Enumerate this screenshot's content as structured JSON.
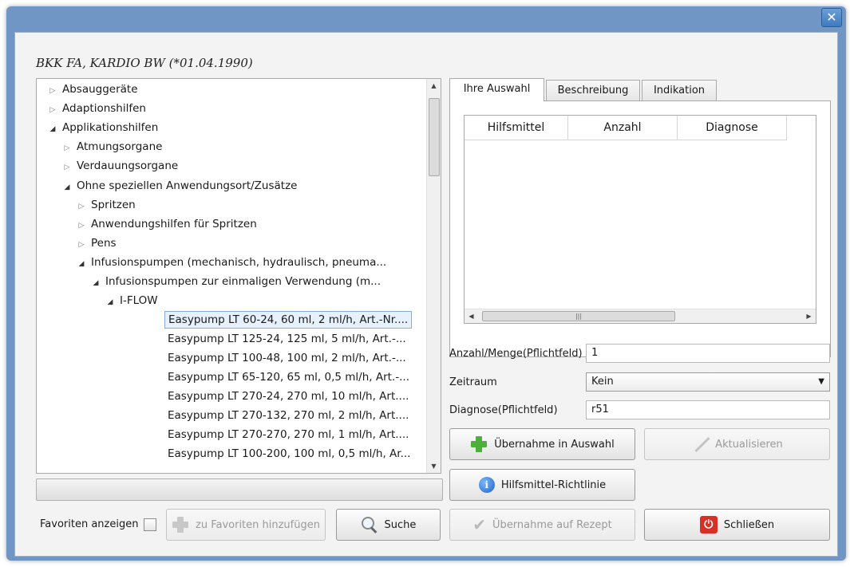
{
  "window": {
    "close_icon": "close-icon"
  },
  "patient": "BKK FA, KARDIO BW (*01.04.1990)",
  "tree": {
    "nodes": [
      {
        "label": "Absauggeräte",
        "state": "collapsed"
      },
      {
        "label": "Adaptionshilfen",
        "state": "collapsed"
      },
      {
        "label": "Applikationshilfen",
        "state": "expanded"
      },
      {
        "label": "Atmungsorgane",
        "state": "collapsed"
      },
      {
        "label": "Verdauungsorgane",
        "state": "collapsed"
      },
      {
        "label": "Ohne speziellen Anwendungsort/Zusätze",
        "state": "expanded"
      },
      {
        "label": "Spritzen",
        "state": "collapsed"
      },
      {
        "label": "Anwendungshilfen für Spritzen",
        "state": "collapsed"
      },
      {
        "label": "Pens",
        "state": "collapsed"
      },
      {
        "label": "Infusionspumpen (mechanisch, hydraulisch, pneuma...",
        "state": "expanded"
      },
      {
        "label": "Infusionspumpen zur einmaligen Verwendung (m...",
        "state": "expanded"
      },
      {
        "label": "I-FLOW",
        "state": "expanded"
      },
      {
        "label": "Easypump LT 60-24, 60 ml, 2 ml/h, Art.-Nr....",
        "state": "leaf",
        "selected": true
      },
      {
        "label": "Easypump LT 125-24, 125 ml, 5 ml/h, Art.-...",
        "state": "leaf"
      },
      {
        "label": "Easypump LT 100-48, 100 ml, 2 ml/h, Art.-...",
        "state": "leaf"
      },
      {
        "label": "Easypump LT 65-120, 65 ml, 0,5 ml/h, Art.-...",
        "state": "leaf"
      },
      {
        "label": "Easypump LT 270-24, 270 ml, 10 ml/h, Art....",
        "state": "leaf"
      },
      {
        "label": "Easypump LT 270-132, 270 ml, 2 ml/h, Art....",
        "state": "leaf"
      },
      {
        "label": "Easypump LT 270-270, 270 ml, 1 ml/h, Art....",
        "state": "leaf"
      },
      {
        "label": "Easypump LT 100-200, 100 ml, 0,5 ml/h, Ar...",
        "state": "leaf"
      }
    ]
  },
  "bottom_left": {
    "favorites_label": "Favoriten anzeigen",
    "add_favorites": "zu Favoriten hinzufügen",
    "search": "Suche"
  },
  "tabs": [
    {
      "label": "Ihre Auswahl",
      "active": true
    },
    {
      "label": "Beschreibung",
      "active": false
    },
    {
      "label": "Indikation",
      "active": false
    }
  ],
  "grid": {
    "columns": [
      "Hilfsmittel",
      "Anzahl",
      "Diagnose",
      ""
    ]
  },
  "form": {
    "quantity_label": "Anzahl/Menge(Pflichtfeld)",
    "quantity_value": "1",
    "period_label": "Zeitraum",
    "period_value": "Kein",
    "diagnosis_label": "Diagnose(Pflichtfeld)",
    "diagnosis_value": "r51"
  },
  "buttons": {
    "take_over": "Übernahme in Auswahl",
    "update": "Aktualisieren",
    "guideline": "Hilfsmittel-Richtlinie",
    "take_over_prescription": "Übernahme auf Rezept",
    "close": "Schließen"
  },
  "colors": {
    "accent": "#3f7bc0",
    "title_bar": "#6f96c4",
    "green_plus": "#4caf3a",
    "close_red": "#d93025"
  }
}
